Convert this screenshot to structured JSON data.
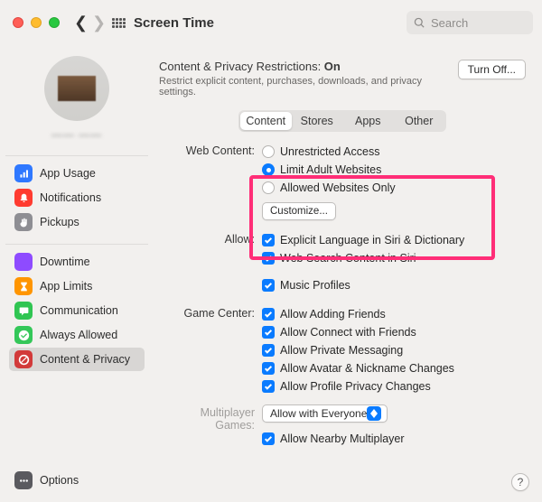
{
  "window": {
    "title": "Screen Time",
    "search_placeholder": "Search"
  },
  "user_name": "—— ——",
  "sidebar": {
    "group1": [
      {
        "label": "App Usage",
        "icon": "bars",
        "color": "blue"
      },
      {
        "label": "Notifications",
        "icon": "bell",
        "color": "red"
      },
      {
        "label": "Pickups",
        "icon": "hand",
        "color": "gray"
      }
    ],
    "group2": [
      {
        "label": "Downtime",
        "icon": "moon",
        "color": "purple"
      },
      {
        "label": "App Limits",
        "icon": "hourglass",
        "color": "orange"
      },
      {
        "label": "Communication",
        "icon": "chat",
        "color": "green"
      },
      {
        "label": "Always Allowed",
        "icon": "check",
        "color": "green2"
      },
      {
        "label": "Content & Privacy",
        "icon": "no",
        "color": "darkred",
        "selected": true
      }
    ],
    "options": {
      "label": "Options",
      "icon": "dots",
      "color": "dark"
    }
  },
  "head": {
    "title_prefix": "Content & Privacy Restrictions: ",
    "title_state": "On",
    "subtitle": "Restrict explicit content, purchases, downloads, and privacy settings.",
    "turn_off": "Turn Off..."
  },
  "tabs": [
    "Content",
    "Stores",
    "Apps",
    "Other"
  ],
  "active_tab": 0,
  "sections": {
    "web_content": {
      "label": "Web Content:",
      "options": [
        "Unrestricted Access",
        "Limit Adult Websites",
        "Allowed Websites Only"
      ],
      "selected": 1,
      "customize": "Customize..."
    },
    "allow": {
      "label": "Allow:",
      "items": [
        "Explicit Language in Siri & Dictionary",
        "Web Search Content in Siri",
        "Music Profiles"
      ]
    },
    "game_center": {
      "label": "Game Center:",
      "items": [
        "Allow Adding Friends",
        "Allow Connect with Friends",
        "Allow Private Messaging",
        "Allow Avatar & Nickname Changes",
        "Allow Profile Privacy Changes"
      ]
    },
    "multiplayer": {
      "label": "Multiplayer Games:",
      "popup": "Allow with Everyone",
      "nearby": "Allow Nearby Multiplayer"
    }
  },
  "help": "?"
}
